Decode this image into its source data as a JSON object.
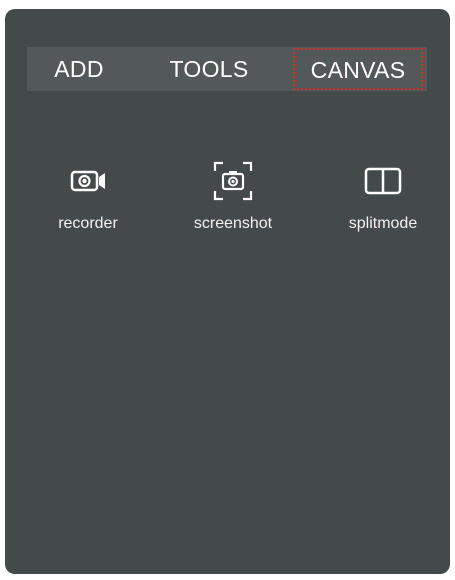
{
  "tabs": [
    {
      "label": "ADD",
      "selected": false
    },
    {
      "label": "TOOLS",
      "selected": false
    },
    {
      "label": "CANVAS",
      "selected": true
    }
  ],
  "tools": [
    {
      "label": "recorder",
      "icon": "video-camera-icon"
    },
    {
      "label": "screenshot",
      "icon": "screenshot-camera-icon"
    },
    {
      "label": "splitmode",
      "icon": "split-screen-icon"
    }
  ],
  "colors": {
    "panel_bg": "#434a49",
    "tabbar_bg": "#525958",
    "text": "#ffffff",
    "selection_outline": "#d92a2a"
  }
}
